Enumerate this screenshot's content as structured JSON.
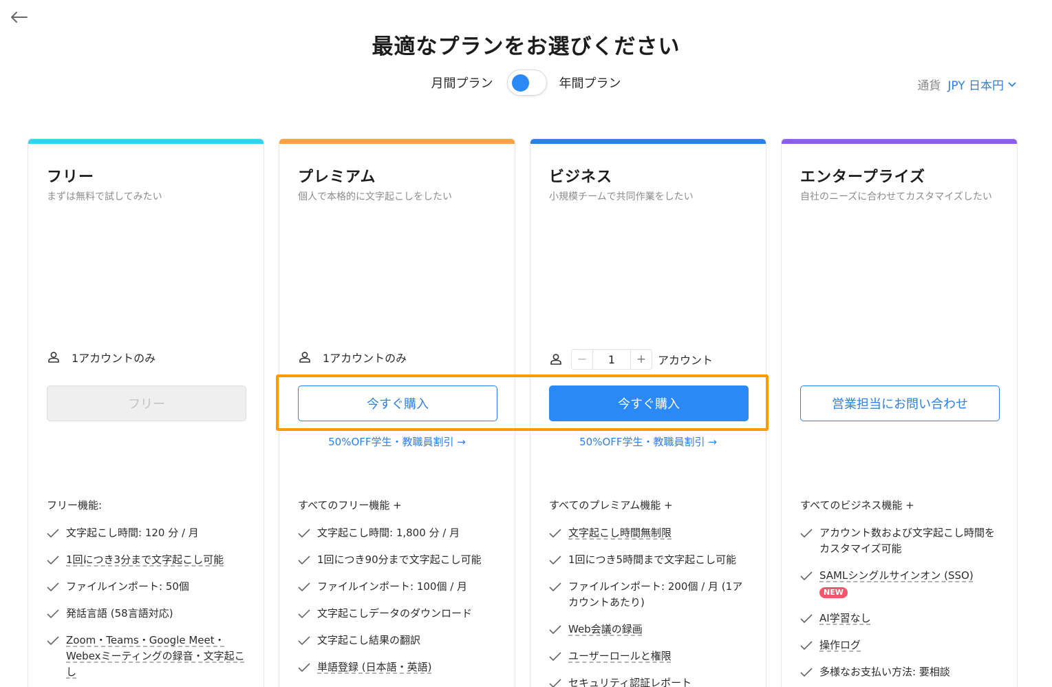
{
  "header": {
    "title": "最適なプランをお選びください",
    "billing_monthly": "月間プラン",
    "billing_yearly": "年間プラン",
    "currency_label": "通貨",
    "currency_value": "JPY 日本円"
  },
  "colors": {
    "free": "#37d1f0",
    "premium": "#f8a33f",
    "business": "#2b7fe8",
    "enterprise": "#8b5cf0",
    "highlight": "#ff9b00"
  },
  "plans": [
    {
      "name": "フリー",
      "desc": "まずは無料で試してみたい",
      "seat": "1アカウントのみ",
      "button": "フリー",
      "features_header": "フリー機能:",
      "features": [
        "文字起こし時間: 120 分 / 月",
        "1回につき3分まで文字起こし可能",
        "ファイルインポート: 50個",
        "発話言語 (58言語対応)",
        "Zoom・Teams・Google Meet・Webexミーティングの録音・文字起こし"
      ]
    },
    {
      "name": "プレミアム",
      "desc": "個人で本格的に文字起こしをしたい",
      "seat": "1アカウントのみ",
      "button": "今すぐ購入",
      "discount": "50%OFF学生・教職員割引 →",
      "features_header": "すべてのフリー機能 +",
      "features": [
        "文字起こし時間: 1,800 分 / 月",
        "1回につき90分まで文字起こし可能",
        "ファイルインポート: 100個 / 月",
        "文字起こしデータのダウンロード",
        "文字起こし結果の翻訳",
        "単語登録 (日本語・英語)"
      ]
    },
    {
      "name": "ビジネス",
      "desc": "小規模チームで共同作業をしたい",
      "seat_count": "1",
      "seat_minus": "−",
      "seat_plus": "+",
      "seat_unit": "アカウント",
      "button": "今すぐ購入",
      "discount": "50%OFF学生・教職員割引 →",
      "features_header": "すべてのプレミアム機能 +",
      "features": [
        "文字起こし時間無制限",
        "1回につき5時間まで文字起こし可能",
        "ファイルインポート: 200個 / 月 (1アカウントあたり)",
        "Web会議の録画",
        "ユーザーロールと権限",
        "セキュリティ認証レポート"
      ]
    },
    {
      "name": "エンタープライズ",
      "desc": "自社のニーズに合わせてカスタマイズしたい",
      "button": "営業担当にお問い合わせ",
      "features_header": "すべてのビジネス機能 +",
      "features": [
        "アカウント数および文字起こし時間をカスタマイズ可能",
        "SAMLシングルサインオン (SSO)",
        "AI学習なし",
        "操作ログ",
        "多様なお支払い方法: 要相談"
      ],
      "new_badge": "NEW"
    }
  ]
}
